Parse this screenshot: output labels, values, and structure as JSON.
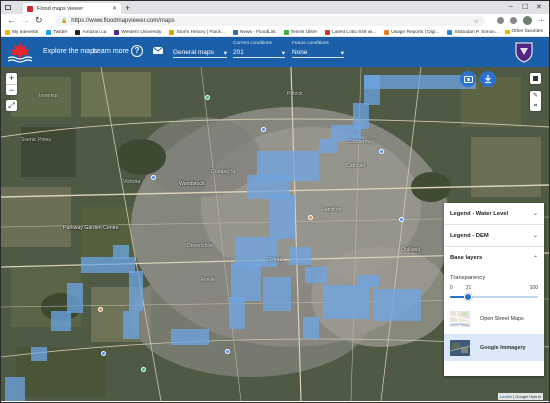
{
  "browser": {
    "tab_title": "Flood maps viewer",
    "new_tab": "+",
    "url": "https://www.floodmapviewer.com/maps",
    "bookmarks": [
      {
        "label": "My Interests",
        "color": "#f1b400"
      },
      {
        "label": "Twitter",
        "color": "#1da1f2"
      },
      {
        "label": "Amazon.ca",
        "color": "#222222"
      },
      {
        "label": "Western University",
        "color": "#4f2683"
      },
      {
        "label": "Storm History | Flack...",
        "color": "#d9a300"
      },
      {
        "label": "News - FloodList",
        "color": "#2b6cb0"
      },
      {
        "label": "Tennis Ulitre",
        "color": "#3cb043"
      },
      {
        "label": "Latest Lotto 649 wi...",
        "color": "#c0392b"
      },
      {
        "label": "Usage Reports | Digi...",
        "color": "#e67e22"
      },
      {
        "label": "Slobodan P. Simon...",
        "color": "#1e88e5"
      }
    ],
    "other_favorites": "Other favorites"
  },
  "header": {
    "explore_label": "Explore the maps",
    "learn_label": "Learn more",
    "help_label": "?",
    "general_maps": "General maps",
    "current_conditions_caption": "Current conditions",
    "current_conditions_value": "201",
    "future_conditions_caption": "Future conditions",
    "future_conditions_value": "None",
    "brand_color": "#1b5fa8"
  },
  "map": {
    "place_labels": [
      "Innerkip",
      "Woodstock",
      "Scenic Pines",
      "Victoria",
      "Cathcart",
      "Dundas St",
      "Parkway Garden Centre",
      "Hamilton",
      "Devonshire",
      "Pittock",
      "Oxford",
      "Oakland",
      "Canterbury",
      "Finkle"
    ],
    "flood_color": "#6ea5e4"
  },
  "legend": {
    "water_level_title": "Legend - Water Level",
    "dem_title": "Legend - DEM",
    "base_layers_title": "Base layers",
    "transparency_label": "Transparency",
    "slider_min": "0",
    "slider_value": "21",
    "slider_max": "100",
    "transparency_value": 21,
    "basemaps": [
      {
        "label": "Open Street Maps",
        "selected": false
      },
      {
        "label": "Google Immagery",
        "selected": true
      }
    ]
  },
  "attribution": {
    "leaflet": "Leaflet",
    "text": " | Google Hybrid"
  }
}
